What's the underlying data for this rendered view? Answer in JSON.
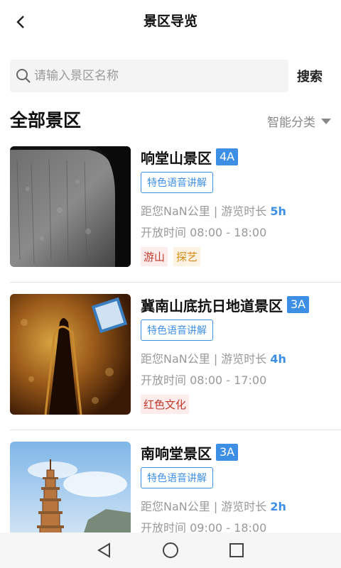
{
  "header": {
    "title": "景区导览",
    "back_icon": "back-arrow-icon"
  },
  "search": {
    "placeholder": "请输入景区名称",
    "button_label": "搜索"
  },
  "section": {
    "title": "全部景区",
    "filter_label": "智能分类"
  },
  "scenic_spots": [
    {
      "name": "响堂山景区",
      "level": "4A",
      "audio_label": "特色语音讲解",
      "distance_prefix": "距您NaN公里 | 游览时长 ",
      "duration": "5h",
      "hours": "开放时间 08:00 - 18:00",
      "tags": [
        "游山",
        "探艺"
      ]
    },
    {
      "name": "冀南山底抗日地道景区",
      "level": "3A",
      "audio_label": "特色语音讲解",
      "distance_prefix": "距您NaN公里 | 游览时长 ",
      "duration": "4h",
      "hours": "开放时间 08:00 - 17:00",
      "tags": [
        "红色文化"
      ]
    },
    {
      "name": "南响堂景区",
      "level": "3A",
      "audio_label": "特色语音讲解",
      "distance_prefix": "距您NaN公里 | 游览时长 ",
      "duration": "2h",
      "hours": "开放时间 09:00 - 18:00",
      "tags": []
    }
  ],
  "colors": {
    "accent": "#3d8fe6",
    "tag_red": "#c0392b",
    "tag_orange": "#d68a16"
  }
}
